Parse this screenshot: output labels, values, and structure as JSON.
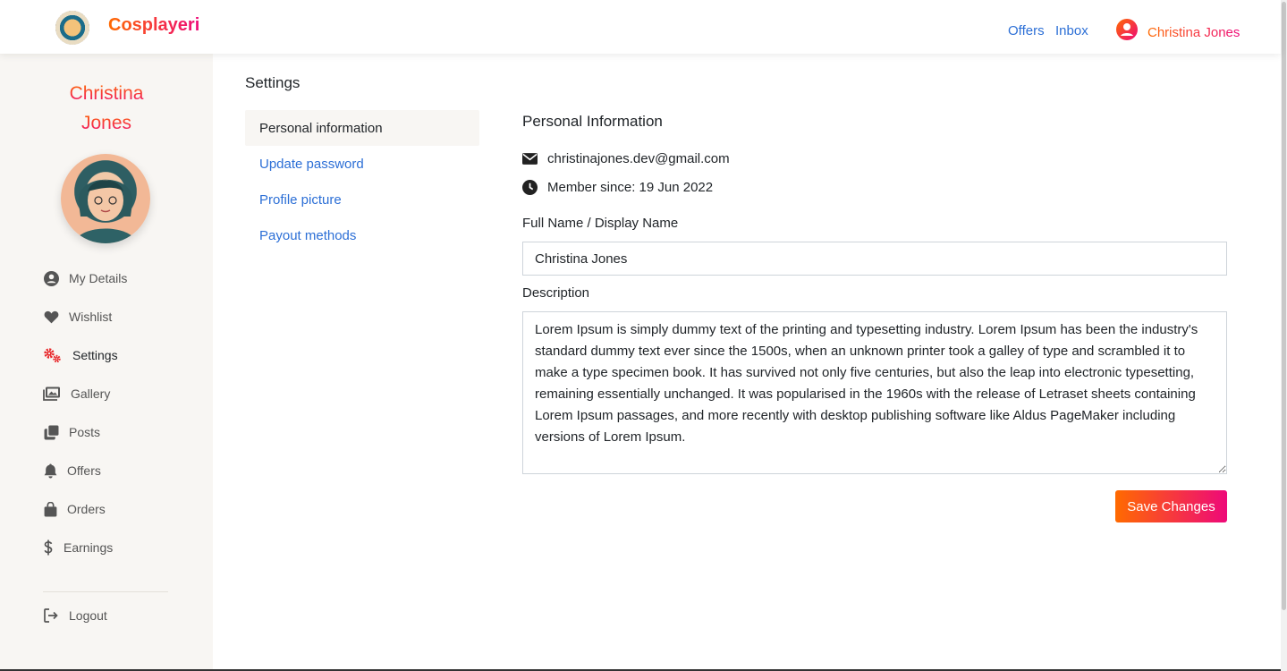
{
  "header": {
    "brand": "Cosplayeri",
    "nav": {
      "offers": "Offers",
      "inbox": "Inbox"
    },
    "user_name": "Christina Jones"
  },
  "sidebar": {
    "first_name": "Christina",
    "last_name": "Jones",
    "items": [
      {
        "label": "My Details",
        "icon": "user-circle-icon"
      },
      {
        "label": "Wishlist",
        "icon": "heart-icon"
      },
      {
        "label": "Settings",
        "icon": "gears-icon"
      },
      {
        "label": "Gallery",
        "icon": "images-icon"
      },
      {
        "label": "Posts",
        "icon": "clone-icon"
      },
      {
        "label": "Offers",
        "icon": "bell-icon"
      },
      {
        "label": "Orders",
        "icon": "shopping-bag-icon"
      },
      {
        "label": "Earnings",
        "icon": "dollar-icon"
      }
    ],
    "logout": "Logout"
  },
  "settings": {
    "title": "Settings",
    "tabs": [
      "Personal information",
      "Update password",
      "Profile picture",
      "Payout methods"
    ]
  },
  "personal": {
    "title": "Personal Information",
    "email": "christinajones.dev@gmail.com",
    "member_since": "Member since: 19 Jun 2022",
    "full_name_label": "Full Name / Display Name",
    "full_name_value": "Christina Jones",
    "description_label": "Description",
    "description_value": "Lorem Ipsum is simply dummy text of the printing and typesetting industry. Lorem Ipsum has been the industry's standard dummy text ever since the 1500s, when an unknown printer took a galley of type and scrambled it to make a type specimen book. It has survived not only five centuries, but also the leap into electronic typesetting, remaining essentially unchanged. It was popularised in the 1960s with the release of Letraset sheets containing Lorem Ipsum passages, and more recently with desktop publishing software like Aldus PageMaker including versions of Lorem Ipsum.",
    "save_label": "Save Changes"
  },
  "colors": {
    "accent_start": "#ff6a00",
    "accent_end": "#ee0979",
    "link": "#2c6fd6",
    "sidebar_bg": "#f8f6f3",
    "settings_icon": "#e8272a"
  }
}
